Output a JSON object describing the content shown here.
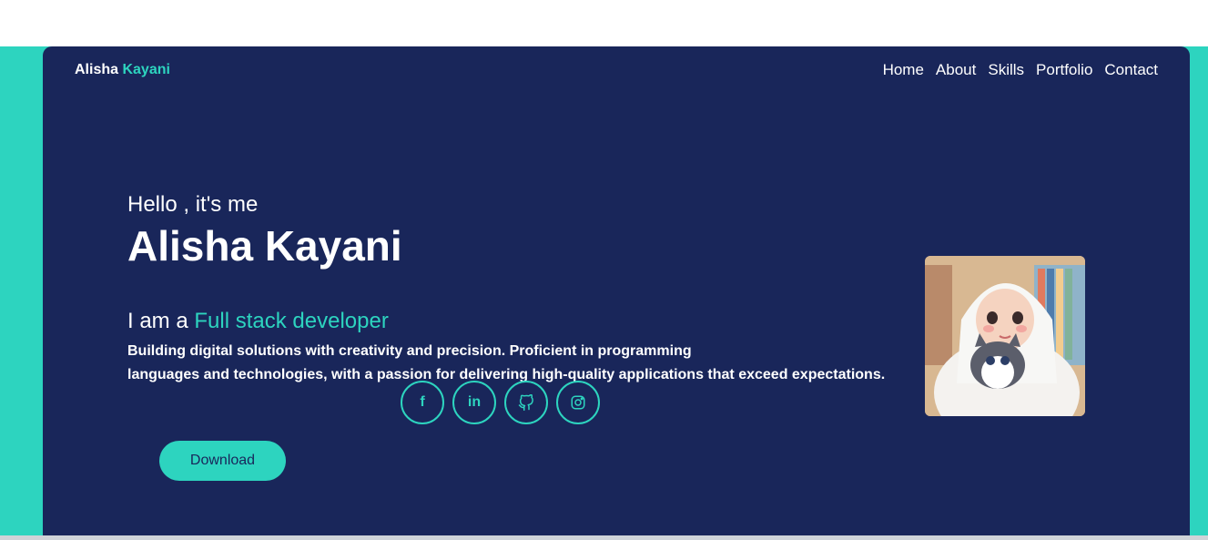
{
  "brand": {
    "first": "Alisha",
    "last": "Kayani"
  },
  "nav": {
    "items": [
      "Home",
      "About",
      "Skills",
      "Portfolio",
      "Contact"
    ]
  },
  "hero": {
    "greeting": "Hello , it's me",
    "name": "Alisha Kayani",
    "role_prefix": "I am a",
    "role": "Full stack developer",
    "description_line1": "Building digital solutions with creativity and precision. Proficient in programming",
    "description_line2": "languages and technologies, with a passion for delivering high-quality applications that exceed expectations."
  },
  "social": {
    "facebook": "f",
    "linkedin": "in"
  },
  "buttons": {
    "download": "Download"
  },
  "colors": {
    "accent": "#2dd4bf",
    "card_bg": "#19265a"
  }
}
